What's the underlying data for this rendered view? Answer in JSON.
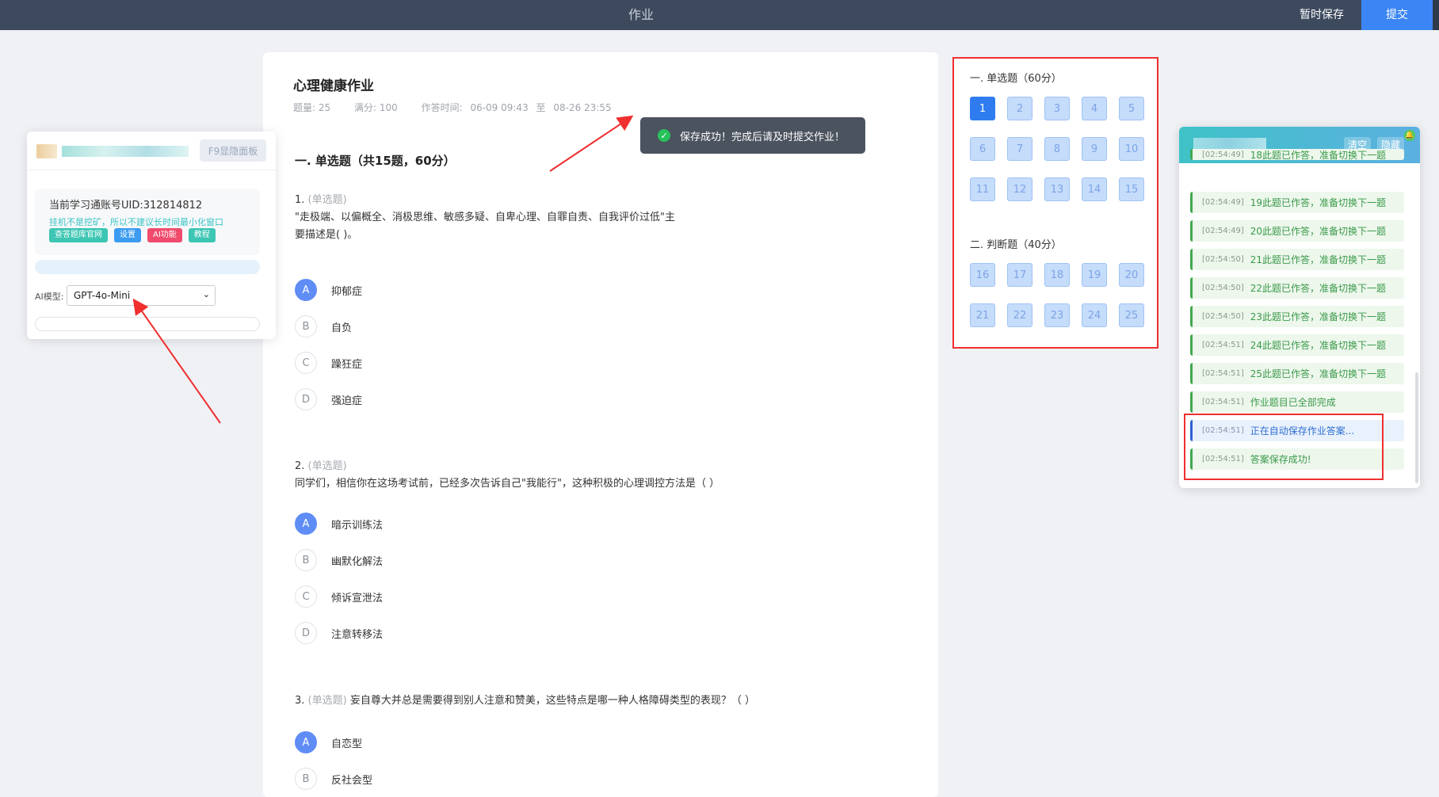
{
  "topbar": {
    "title": "作业",
    "save": "暂时保存",
    "submit": "提交"
  },
  "paper": {
    "title": "心理健康作业",
    "meta": {
      "count": "题量: 25",
      "score": "满分: 100",
      "time_label": "作答时间:",
      "time_start": "06-09 09:43",
      "time_to": "至",
      "time_end": "08-26 23:55"
    },
    "section_title": "一. 单选题（共15题，60分）",
    "questions": [
      {
        "num": "1.",
        "type": "(单选题)",
        "text1": "\"走极端、以偏概全、消极思维、敏感多疑、自卑心理、自罪自责、自我评价过低\"主",
        "text2": "要描述是(    )。",
        "options": [
          {
            "letter": "A",
            "text": "抑郁症"
          },
          {
            "letter": "B",
            "text": "自负"
          },
          {
            "letter": "C",
            "text": "躁狂症"
          },
          {
            "letter": "D",
            "text": "强迫症"
          }
        ]
      },
      {
        "num": "2.",
        "type": "(单选题)",
        "text1": "同学们，相信你在这场考试前，已经多次告诉自己\"我能行\"，这种积极的心理调控方法是（ ）",
        "options": [
          {
            "letter": "A",
            "text": "暗示训练法"
          },
          {
            "letter": "B",
            "text": "幽默化解法"
          },
          {
            "letter": "C",
            "text": "倾诉宣泄法"
          },
          {
            "letter": "D",
            "text": "注意转移法"
          }
        ]
      },
      {
        "num": "3.",
        "type": "(单选题)",
        "text1": "妄自尊大并总是需要得到别人注意和赞美，这些特点是哪一种人格障碍类型的表现？（   ）",
        "options": [
          {
            "letter": "A",
            "text": "自恋型"
          },
          {
            "letter": "B",
            "text": "反社会型"
          }
        ]
      }
    ]
  },
  "toast": {
    "text": "保存成功！完成后请及时提交作业！"
  },
  "card": {
    "sec1": "一. 单选题（60分）",
    "sec2": "二. 判断题（40分）",
    "sec1_nums": [
      "1",
      "2",
      "3",
      "4",
      "5",
      "6",
      "7",
      "8",
      "9",
      "10",
      "11",
      "12",
      "13",
      "14",
      "15"
    ],
    "sec2_nums": [
      "16",
      "17",
      "18",
      "19",
      "20",
      "21",
      "22",
      "23",
      "24",
      "25"
    ]
  },
  "left_panel": {
    "toggle": "F9显隐面板",
    "uid": "当前学习通账号UID:312814812",
    "warning": "挂机不是挖矿，所以不建议长时间最小化窗口",
    "tags": [
      {
        "label": "查答题库官网",
        "color": "#3cc6b3"
      },
      {
        "label": "设置",
        "color": "#3b9bf1"
      },
      {
        "label": "AI功能",
        "color": "#f04b6c"
      },
      {
        "label": "教程",
        "color": "#3cc6b3"
      }
    ],
    "ai_label": "AI模型:",
    "ai_model": "GPT-4o-Mini"
  },
  "right_panel": {
    "clear": "清空",
    "hide": "隐藏",
    "logs": [
      {
        "ts": "[02:54:49]",
        "msg": "18此题已作答，准备切换下一题",
        "kind": "ok"
      },
      {
        "ts": "[02:54:49]",
        "msg": "19此题已作答，准备切换下一题",
        "kind": "ok"
      },
      {
        "ts": "[02:54:49]",
        "msg": "20此题已作答，准备切换下一题",
        "kind": "ok"
      },
      {
        "ts": "[02:54:50]",
        "msg": "21此题已作答，准备切换下一题",
        "kind": "ok"
      },
      {
        "ts": "[02:54:50]",
        "msg": "22此题已作答，准备切换下一题",
        "kind": "ok"
      },
      {
        "ts": "[02:54:50]",
        "msg": "23此题已作答，准备切换下一题",
        "kind": "ok"
      },
      {
        "ts": "[02:54:51]",
        "msg": "24此题已作答，准备切换下一题",
        "kind": "ok"
      },
      {
        "ts": "[02:54:51]",
        "msg": "25此题已作答，准备切换下一题",
        "kind": "ok"
      },
      {
        "ts": "[02:54:51]",
        "msg": "作业题目已全部完成",
        "kind": "ok"
      },
      {
        "ts": "[02:54:51]",
        "msg": "正在自动保存作业答案...",
        "kind": "info"
      },
      {
        "ts": "[02:54:51]",
        "msg": "答案保存成功!",
        "kind": "ok"
      }
    ]
  },
  "colors": {
    "accent": "#3b86f4",
    "selected": "#5f8df5",
    "highlight": "#f02f2f"
  }
}
